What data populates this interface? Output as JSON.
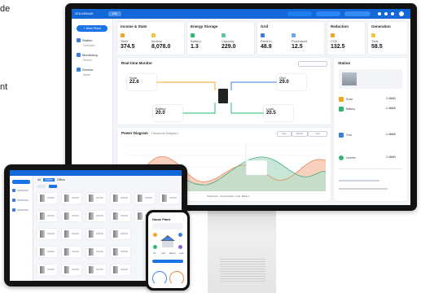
{
  "side_text": [
    "de",
    "nt"
  ],
  "monitor": {
    "topbar": {
      "logo": "SOLARMAN",
      "chip": "EN"
    },
    "sidebar": {
      "new_button": "+ New Plant",
      "items": [
        {
          "label": "Station",
          "sub": "Overview"
        },
        {
          "label": "Monitoring",
          "sub": "Device"
        },
        {
          "label": "Service",
          "sub": "Alarm"
        }
      ]
    },
    "cards": [
      {
        "title": "Income & Stats",
        "metrics": [
          {
            "label": "Yield",
            "value": "374.5"
          },
          {
            "label": "Income",
            "value": "8,078.0"
          }
        ]
      },
      {
        "title": "Energy Storage",
        "metrics": [
          {
            "label": "Battery",
            "value": "1.3"
          },
          {
            "label": "Capacity",
            "value": "229.0"
          }
        ]
      },
      {
        "title": "Grid",
        "metrics": [
          {
            "label": "Feed-in",
            "value": "48.9"
          },
          {
            "label": "Purchased",
            "value": "12.5"
          }
        ]
      },
      {
        "title": "Reduction",
        "metrics": [
          {
            "label": "CO2",
            "value": "132.5"
          }
        ]
      },
      {
        "title": "Generation",
        "metrics": [
          {
            "label": "Total",
            "value": "58.5"
          }
        ]
      }
    ],
    "flow": {
      "title": "Real-time Monitor",
      "nodes": [
        {
          "label": "Solar",
          "value": "22.6"
        },
        {
          "label": "Grid",
          "value": "29.0"
        },
        {
          "label": "Battery",
          "value": "20.0"
        },
        {
          "label": "Load",
          "value": "20.5"
        }
      ]
    },
    "chart": {
      "title": "Power Diagram",
      "subtitle": "Historical Diagram",
      "filters": [
        "Day",
        "Month",
        "Year"
      ],
      "legend": [
        "Production",
        "Consumption",
        "Grid",
        "Battery"
      ]
    },
    "stats_panel": {
      "title": "Station",
      "items": [
        {
          "label": "Solar",
          "value": "1.46kW"
        },
        {
          "label": "Battery",
          "value": "1.46kW"
        },
        {
          "label": "Grid",
          "value": "1.46kW"
        },
        {
          "label": "Inverter",
          "value": "1.46kW"
        }
      ]
    }
  },
  "tablet": {
    "tabs": [
      "All",
      "Online",
      "Offline"
    ]
  },
  "phone": {
    "title": "Home Plant",
    "labels": [
      "PV",
      "Grid",
      "Battery",
      "Load"
    ]
  },
  "colors": {
    "brand": "#1467d6",
    "production": "#f2a98a",
    "consumption": "#9fd3b9",
    "accent_green": "#2eb872",
    "accent_orange": "#f5a524"
  }
}
